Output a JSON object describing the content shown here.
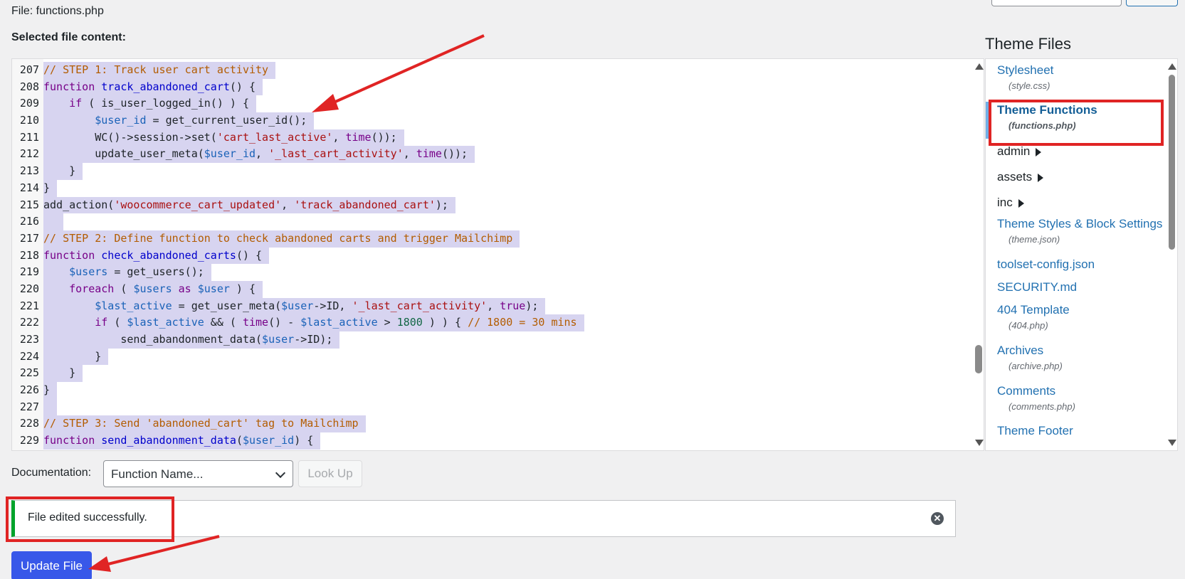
{
  "header": {
    "file_title": "File: functions.php",
    "selected_label": "Selected file content:"
  },
  "editor": {
    "lines": [
      {
        "n": "207",
        "tokens": [
          [
            "c-comment",
            "// STEP 1: Track user cart activity"
          ]
        ]
      },
      {
        "n": "208",
        "tokens": [
          [
            "c-kw",
            "function "
          ],
          [
            "c-def",
            "track_abandoned_cart"
          ],
          [
            "c-plain",
            "() {"
          ]
        ]
      },
      {
        "n": "209",
        "tokens": [
          [
            "c-plain",
            "    "
          ],
          [
            "c-kw",
            "if"
          ],
          [
            "c-plain",
            " ( is_user_logged_in() ) {"
          ]
        ]
      },
      {
        "n": "210",
        "tokens": [
          [
            "c-plain",
            "        "
          ],
          [
            "c-var",
            "$user_id"
          ],
          [
            "c-plain",
            " = get_current_user_id();"
          ]
        ]
      },
      {
        "n": "211",
        "tokens": [
          [
            "c-plain",
            "        WC()->session->set("
          ],
          [
            "c-str",
            "'cart_last_active'"
          ],
          [
            "c-plain",
            ", "
          ],
          [
            "c-kw",
            "time"
          ],
          [
            "c-plain",
            "());"
          ]
        ]
      },
      {
        "n": "212",
        "tokens": [
          [
            "c-plain",
            "        update_user_meta("
          ],
          [
            "c-var",
            "$user_id"
          ],
          [
            "c-plain",
            ", "
          ],
          [
            "c-str",
            "'_last_cart_activity'"
          ],
          [
            "c-plain",
            ", "
          ],
          [
            "c-kw",
            "time"
          ],
          [
            "c-plain",
            "());"
          ]
        ]
      },
      {
        "n": "213",
        "tokens": [
          [
            "c-plain",
            "    }"
          ]
        ]
      },
      {
        "n": "214",
        "tokens": [
          [
            "c-plain",
            "}"
          ]
        ]
      },
      {
        "n": "215",
        "tokens": [
          [
            "c-plain",
            "add_action("
          ],
          [
            "c-str",
            "'woocommerce_cart_updated'"
          ],
          [
            "c-plain",
            ", "
          ],
          [
            "c-str",
            "'track_abandoned_cart'"
          ],
          [
            "c-plain",
            ");"
          ]
        ]
      },
      {
        "n": "216",
        "tokens": [
          [
            "c-plain",
            "  "
          ]
        ]
      },
      {
        "n": "217",
        "tokens": [
          [
            "c-comment",
            "// STEP 2: Define function to check abandoned carts and trigger Mailchimp"
          ]
        ]
      },
      {
        "n": "218",
        "tokens": [
          [
            "c-kw",
            "function "
          ],
          [
            "c-def",
            "check_abandoned_carts"
          ],
          [
            "c-plain",
            "() {"
          ]
        ]
      },
      {
        "n": "219",
        "tokens": [
          [
            "c-plain",
            "    "
          ],
          [
            "c-var",
            "$users"
          ],
          [
            "c-plain",
            " = get_users();"
          ]
        ]
      },
      {
        "n": "220",
        "tokens": [
          [
            "c-plain",
            "    "
          ],
          [
            "c-kw",
            "foreach"
          ],
          [
            "c-plain",
            " ( "
          ],
          [
            "c-var",
            "$users"
          ],
          [
            "c-plain",
            " "
          ],
          [
            "c-kw",
            "as"
          ],
          [
            "c-plain",
            " "
          ],
          [
            "c-var",
            "$user"
          ],
          [
            "c-plain",
            " ) {"
          ]
        ]
      },
      {
        "n": "221",
        "tokens": [
          [
            "c-plain",
            "        "
          ],
          [
            "c-var",
            "$last_active"
          ],
          [
            "c-plain",
            " = get_user_meta("
          ],
          [
            "c-var",
            "$user"
          ],
          [
            "c-plain",
            "->ID, "
          ],
          [
            "c-str",
            "'_last_cart_activity'"
          ],
          [
            "c-plain",
            ", "
          ],
          [
            "c-kw",
            "true"
          ],
          [
            "c-plain",
            ");"
          ]
        ]
      },
      {
        "n": "222",
        "tokens": [
          [
            "c-plain",
            "        "
          ],
          [
            "c-kw",
            "if"
          ],
          [
            "c-plain",
            " ( "
          ],
          [
            "c-var",
            "$last_active"
          ],
          [
            "c-plain",
            " && ( "
          ],
          [
            "c-kw",
            "time"
          ],
          [
            "c-plain",
            "() - "
          ],
          [
            "c-var",
            "$last_active"
          ],
          [
            "c-plain",
            " > "
          ],
          [
            "c-num",
            "1800"
          ],
          [
            "c-plain",
            " ) ) { "
          ],
          [
            "c-comment",
            "// 1800 = 30 mins"
          ]
        ]
      },
      {
        "n": "223",
        "tokens": [
          [
            "c-plain",
            "            send_abandonment_data("
          ],
          [
            "c-var",
            "$user"
          ],
          [
            "c-plain",
            "->ID);"
          ]
        ]
      },
      {
        "n": "224",
        "tokens": [
          [
            "c-plain",
            "        }"
          ]
        ]
      },
      {
        "n": "225",
        "tokens": [
          [
            "c-plain",
            "    }"
          ]
        ]
      },
      {
        "n": "226",
        "tokens": [
          [
            "c-plain",
            "}"
          ]
        ]
      },
      {
        "n": "227",
        "tokens": [
          [
            "c-plain",
            " "
          ]
        ]
      },
      {
        "n": "228",
        "tokens": [
          [
            "c-comment",
            "// STEP 3: Send 'abandoned_cart' tag to Mailchimp"
          ]
        ]
      },
      {
        "n": "229",
        "tokens": [
          [
            "c-kw",
            "function "
          ],
          [
            "c-def",
            "send_abandonment_data"
          ],
          [
            "c-plain",
            "("
          ],
          [
            "c-var",
            "$user_id"
          ],
          [
            "c-plain",
            ") {"
          ]
        ]
      }
    ]
  },
  "theme_files": {
    "heading": "Theme Files",
    "stylesheet": {
      "label": "Stylesheet",
      "sub": "(style.css)"
    },
    "functions": {
      "label": "Theme Functions",
      "sub": "(functions.php)"
    },
    "admin": "admin",
    "assets": "assets",
    "inc": "inc",
    "theme_json": {
      "label": "Theme Styles & Block Settings",
      "sub": "(theme.json)"
    },
    "toolset": "toolset-config.json",
    "security": "SECURITY.md",
    "template_404": {
      "label": "404 Template",
      "sub": "(404.php)"
    },
    "archives": {
      "label": "Archives",
      "sub": "(archive.php)"
    },
    "comments": {
      "label": "Comments",
      "sub": "(comments.php)"
    },
    "footer": "Theme Footer"
  },
  "documentation": {
    "label": "Documentation:",
    "select_value": "Function Name...",
    "lookup_label": "Look Up"
  },
  "notice": {
    "text": "File edited successfully.",
    "dismiss_glyph": "✕"
  },
  "actions": {
    "update_label": "Update File"
  },
  "colors": {
    "selection": "#d7d4f0",
    "annotation": "#e02424",
    "primary_button": "#3858e9",
    "success": "#00a32a",
    "link": "#2271b1"
  }
}
